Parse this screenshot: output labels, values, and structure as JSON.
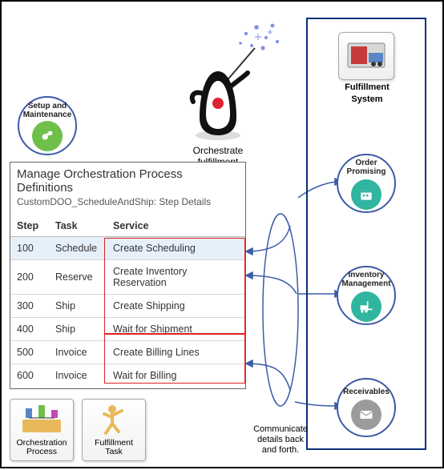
{
  "setup": {
    "label": "Setup and Maintenance"
  },
  "orchestrate": {
    "label_l1": "Orchestrate",
    "label_l2": "fulfillment"
  },
  "fulfillment_system": {
    "label_l1": "Fulfillment",
    "label_l2": "System"
  },
  "right_nodes": {
    "order_promising": {
      "l1": "Order",
      "l2": "Promising"
    },
    "inventory_mgmt": {
      "l1": "Inventory",
      "l2": "Management"
    },
    "receivables": {
      "l1": "Receivables"
    }
  },
  "table": {
    "title": "Manage Orchestration Process Definitions",
    "subtitle": "CustomDOO_ScheduleAndShip: Step Details",
    "headers": {
      "step": "Step",
      "task": "Task",
      "service": "Service"
    },
    "rows": [
      {
        "step": "100",
        "task": "Schedule",
        "service": "Create Scheduling",
        "highlighted": true
      },
      {
        "step": "200",
        "task": "Reserve",
        "service": "Create Inventory Reservation"
      },
      {
        "step": "300",
        "task": "Ship",
        "service": "Create Shipping"
      },
      {
        "step": "400",
        "task": "Ship",
        "service": "Wait for Shipment"
      },
      {
        "step": "500",
        "task": "Invoice",
        "service": "Create Billing Lines"
      },
      {
        "step": "600",
        "task": "Invoice",
        "service": "Wait for Billing"
      }
    ]
  },
  "cards": {
    "orchestration_process": {
      "l1": "Orchestration",
      "l2": "Process"
    },
    "fulfillment_task": {
      "l1": "Fulfillment",
      "l2": "Task"
    }
  },
  "communicate": {
    "l1": "Communicate",
    "l2": "details back",
    "l3": "and forth."
  }
}
